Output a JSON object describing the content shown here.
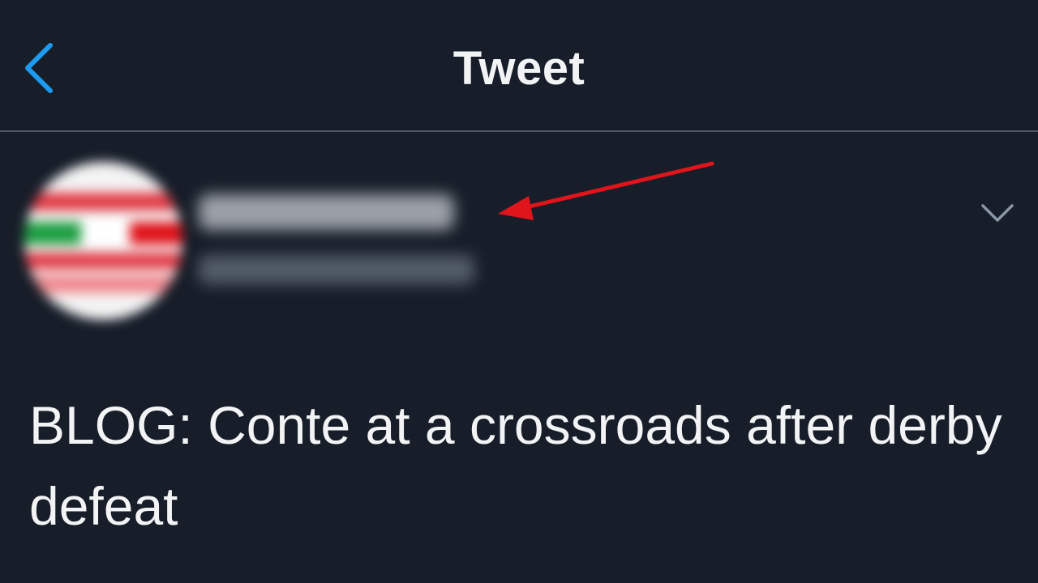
{
  "header": {
    "title": "Tweet",
    "back_icon": "chevron-left-icon"
  },
  "tweet": {
    "text": "BLOG: Conte at a crossroads after derby defeat",
    "more_icon": "chevron-down-icon"
  },
  "colors": {
    "background": "#171e29",
    "accent": "#1d9bf0",
    "text": "#f2f3f5",
    "divider": "#4a5869",
    "annotation": "#e0141b"
  }
}
